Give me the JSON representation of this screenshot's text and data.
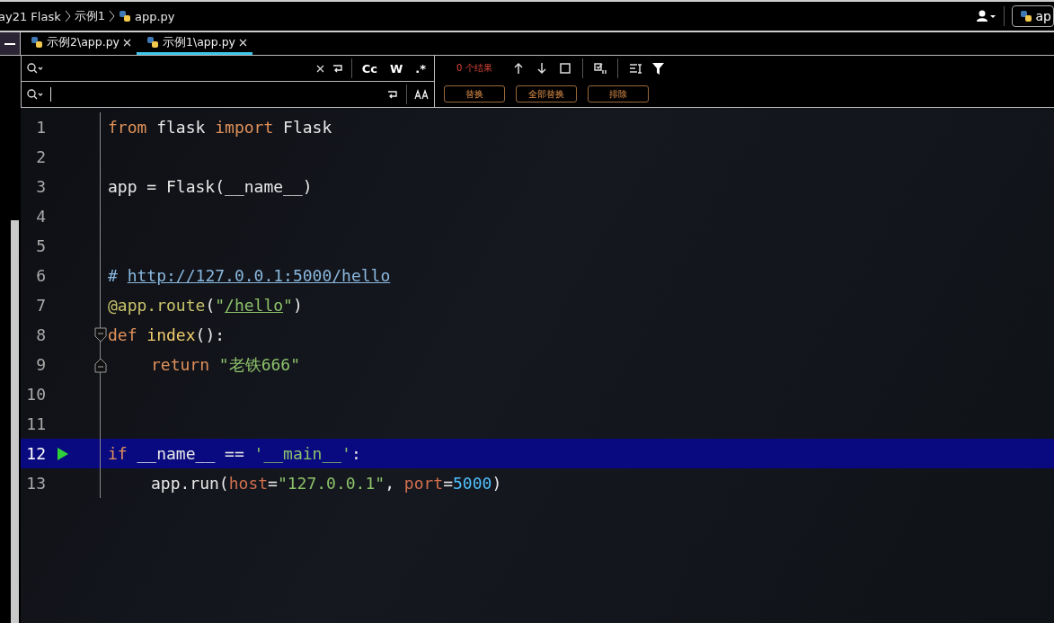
{
  "breadcrumb": [
    {
      "label": "ay21 Flask"
    },
    {
      "label": "示例1"
    },
    {
      "label": "app.py"
    }
  ],
  "run_config": {
    "label": "ap"
  },
  "tabs": [
    {
      "label": "示例2\\app.py",
      "selected": false
    },
    {
      "label": "示例1\\app.py",
      "selected": true
    }
  ],
  "find": {
    "result": "0 个结果",
    "toggles": [
      "Cc",
      "W",
      ".*"
    ]
  },
  "replace": {
    "buttons": [
      "替换",
      "全部替换",
      "排除"
    ]
  },
  "lines": [
    {
      "number": "1",
      "current": false,
      "kind": "plain",
      "tokens": [
        {
          "kind": "kw",
          "text": "from"
        },
        {
          "kind": "plain",
          "text": " flask "
        },
        {
          "kind": "kw",
          "text": "import"
        },
        {
          "kind": "plain",
          "text": " Flask"
        }
      ]
    },
    {
      "number": "2",
      "current": false,
      "kind": "plain"
    },
    {
      "number": "3",
      "current": false,
      "kind": "plain",
      "tokens": [
        {
          "kind": "plain",
          "text": "app = Flask(__name__)"
        }
      ]
    },
    {
      "number": "4",
      "current": false,
      "kind": "plain"
    },
    {
      "number": "5",
      "current": false,
      "kind": "plain"
    },
    {
      "number": "6",
      "current": false,
      "kind": "plain",
      "tokens": [
        {
          "kind": "comment",
          "text": "# "
        },
        {
          "kind": "link",
          "text": "http://127.0.0.1:5000/hello"
        }
      ]
    },
    {
      "number": "7",
      "current": false,
      "kind": "plain",
      "tokens": [
        {
          "kind": "decorator",
          "text": "@app.route"
        },
        {
          "kind": "plain",
          "text": "("
        },
        {
          "kind": "str",
          "text": "\""
        },
        {
          "kind": "strlink",
          "text": "/hello"
        },
        {
          "kind": "str",
          "text": "\""
        },
        {
          "kind": "plain",
          "text": ")"
        }
      ]
    },
    {
      "number": "8",
      "current": false,
      "kind": "fold-start",
      "tokens": [
        {
          "kind": "kw",
          "text": "def "
        },
        {
          "kind": "fn",
          "text": "index"
        },
        {
          "kind": "plain",
          "text": "():"
        }
      ],
      "children": [
        {
          "number": "9",
          "current": false,
          "kind": "fold-end",
          "tokens": [
            {
              "kind": "kw",
              "text": "return "
            },
            {
              "kind": "str",
              "text": "\"老铁666\""
            }
          ]
        }
      ]
    },
    {
      "number": "10",
      "current": false,
      "kind": "plain"
    },
    {
      "number": "11",
      "current": false,
      "kind": "plain"
    },
    {
      "number": "12",
      "current": true,
      "kind": "run",
      "tokens": [
        {
          "kind": "kw",
          "text": "if"
        },
        {
          "kind": "plain",
          "text": " __name__ == "
        },
        {
          "kind": "str",
          "text": "'__main__'"
        },
        {
          "kind": "plain",
          "text": ":"
        }
      ],
      "children": [
        {
          "number": "13",
          "current": false,
          "kind": "plain",
          "tokens": [
            {
              "kind": "plain",
              "text": "app.run("
            },
            {
              "kind": "param",
              "text": "host"
            },
            {
              "kind": "plain",
              "text": "="
            },
            {
              "kind": "str",
              "text": "\"127.0.0.1\""
            },
            {
              "kind": "plain",
              "text": ", "
            },
            {
              "kind": "param",
              "text": "port"
            },
            {
              "kind": "plain",
              "text": "="
            },
            {
              "kind": "num",
              "text": "5000"
            },
            {
              "kind": "plain",
              "text": ")"
            }
          ]
        }
      ]
    }
  ]
}
